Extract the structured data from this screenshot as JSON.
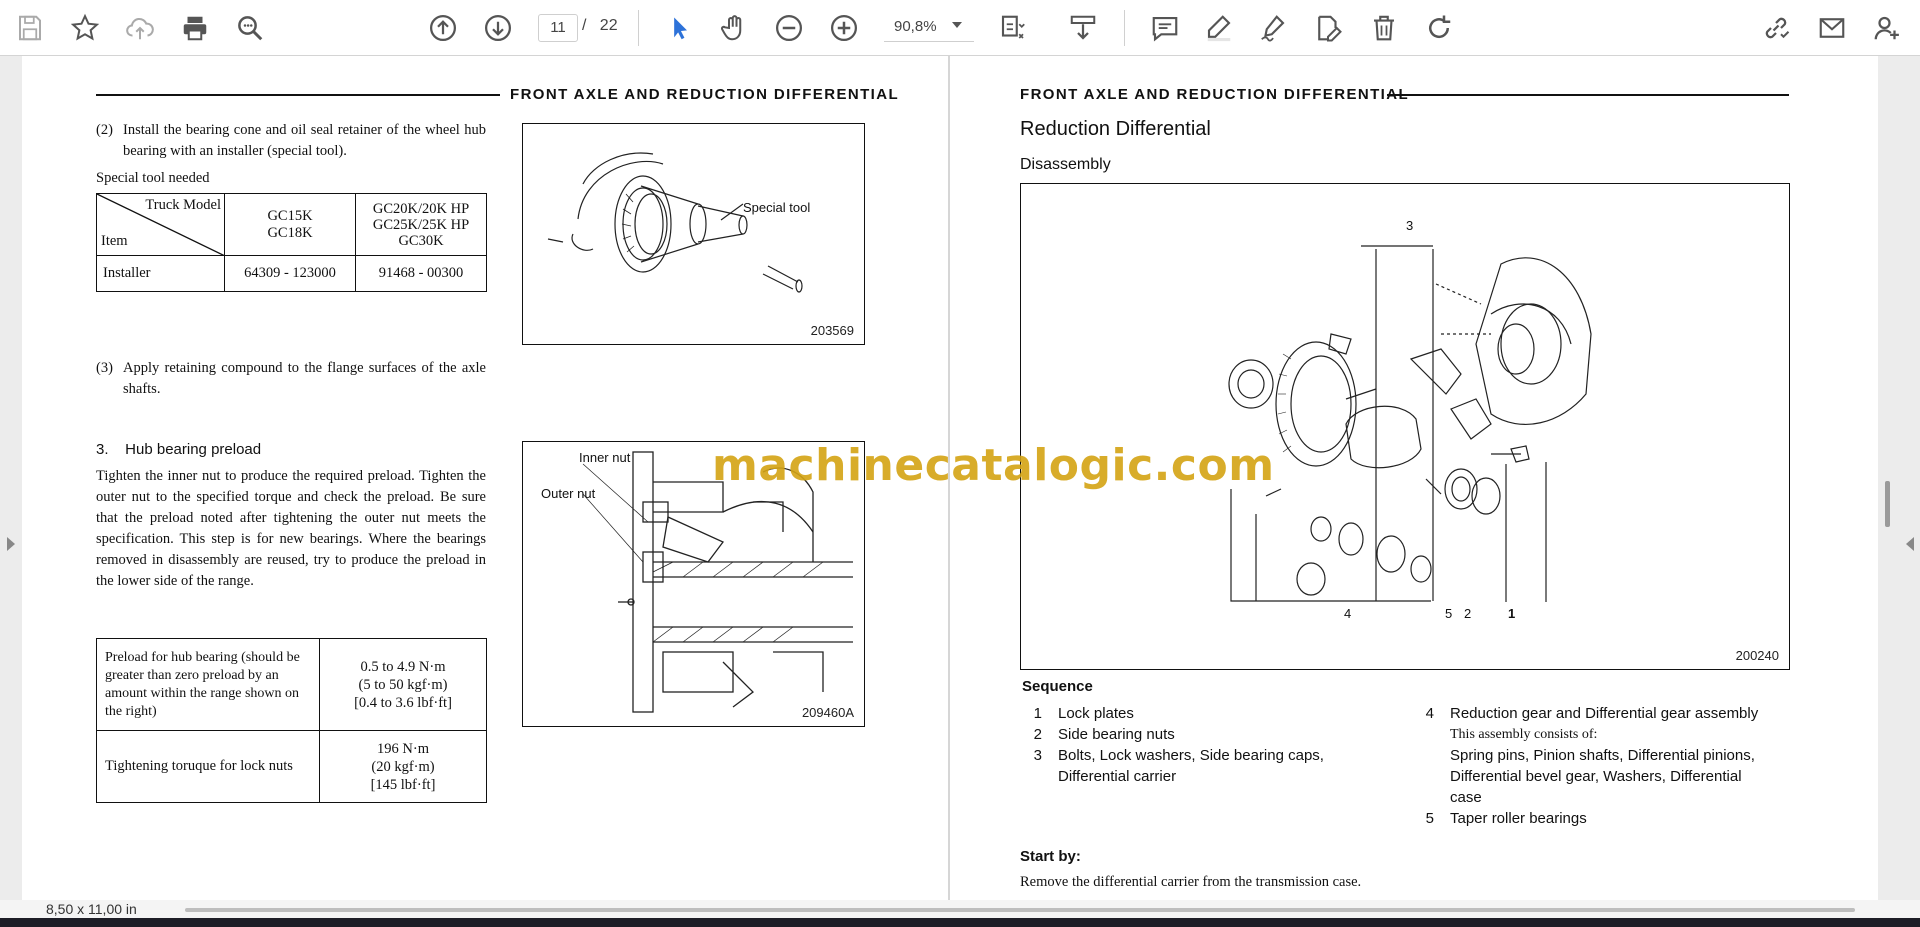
{
  "toolbar": {
    "page_current": "11",
    "page_separator": "/",
    "page_total": "22",
    "zoom": "90,8%",
    "icons": [
      "save-icon",
      "bookmark-star-icon",
      "upload-cloud-icon",
      "print-icon",
      "find-icon",
      "previous-page-icon",
      "next-page-icon",
      "select-cursor-icon",
      "hand-pan-icon",
      "zoom-out-icon",
      "zoom-in-icon",
      "page-fit-icon",
      "download-icon",
      "comment-icon",
      "highlight-icon",
      "sign-icon",
      "edit-pdf-icon",
      "delete-icon",
      "rotate-icon",
      "share-link-icon",
      "email-icon",
      "add-user-icon"
    ],
    "accent": "#2d72d9"
  },
  "left_page": {
    "header": "FRONT  AXLE  AND  REDUCTION  DIFFERENTIAL",
    "step2": {
      "num": "(2)",
      "text": "Install the bearing cone and oil seal retainer of the wheel hub bearing with an installer (special tool)."
    },
    "special_tool_label": "Special tool needed",
    "tool_table": {
      "hdr_truck_model": "Truck Model",
      "hdr_item": "Item",
      "col1": [
        "GC15K",
        "GC18K"
      ],
      "col2": [
        "GC20K/20K HP",
        "GC25K/25K HP",
        "GC30K"
      ],
      "row_item": "Installer",
      "row_col1": "64309 - 123000",
      "row_col2": "91468 - 00300"
    },
    "figure1": {
      "id": "203569",
      "label": "Special tool"
    },
    "step3": {
      "num": "(3)",
      "text": "Apply retaining compound to the flange surfaces of the axle shafts."
    },
    "section3_title": "3.    Hub bearing preload",
    "section3_text": "Tighten the inner nut to produce the required preload.  Tighten the outer nut to the specified torque and check the preload.  Be sure that the preload noted after tightening the outer nut meets the specification.  This step is for new bearings.  Where the bearings removed in disassembly are reused, try to produce the preload in the lower side of the range.",
    "preload_table": {
      "r1_label": "Preload for hub bearing (should be greater than zero preload by an amount within the range shown on the right)",
      "r1_values": [
        "0.5 to 4.9 N·m",
        "(5 to 50 kgf·m)",
        "[0.4  to 3.6 lbf·ft]"
      ],
      "r2_label": "Tightening toruque for lock nuts",
      "r2_values": [
        "196 N·m",
        "(20 kgf·m)",
        "[145 lbf·ft]"
      ]
    },
    "figure2": {
      "id": "209460A",
      "label_inner": "Inner nut",
      "label_outer": "Outer nut"
    }
  },
  "right_page": {
    "header": "FRONT  AXLE  AND  REDUCTION  DIFFERENTIAL",
    "title": "Reduction Differential",
    "subtitle": "Disassembly",
    "figure": {
      "id": "200240",
      "callout_3": "3",
      "callout_4": "4",
      "callout_5": "5",
      "callout_2": "2",
      "callout_1": "1"
    },
    "sequence_title": "Sequence",
    "sequence": [
      {
        "n": "1",
        "text": "Lock plates"
      },
      {
        "n": "2",
        "text": "Side bearing nuts"
      },
      {
        "n": "3",
        "text": "Bolts, Lock washers, Side bearing caps,",
        "text2": "Differential carrier"
      },
      {
        "n": "4",
        "text": "Reduction gear and Differential gear assembly",
        "sub": "This assembly consists of:",
        "text2": "Spring pins, Pinion shafts, Differential pinions,",
        "text3": "Differential bevel gear, Washers, Differential",
        "text4": "case"
      },
      {
        "n": "5",
        "text": "Taper roller bearings"
      }
    ],
    "start_by_title": "Start by:",
    "start_by_text": "Remove the differential carrier from the transmission case."
  },
  "watermark": "machinecatalogic.com",
  "status": {
    "page_size": "8,50 x 11,00 in"
  }
}
